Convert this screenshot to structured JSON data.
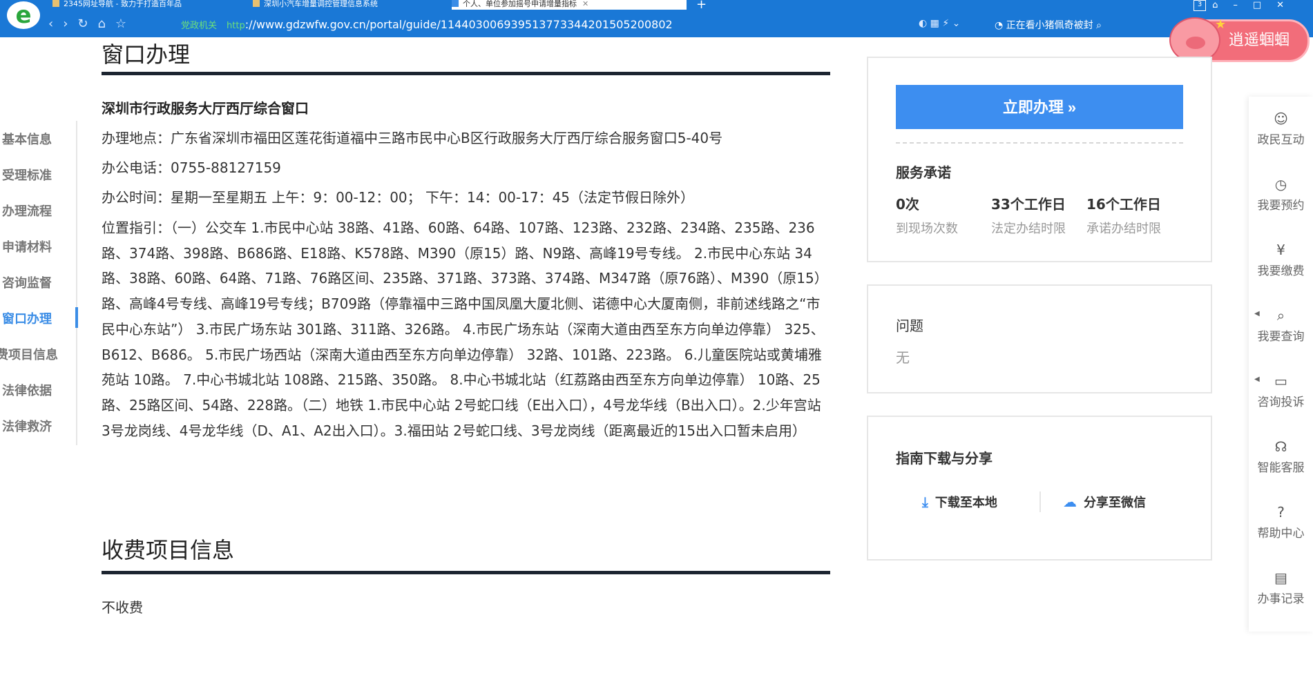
{
  "browser": {
    "tabs": [
      {
        "label": "2345网址导航 - 致力于打造百年品"
      },
      {
        "label": "深圳小汽车增量调控管理信息系统"
      },
      {
        "label": "个人、单位参加摇号申请增量指标"
      }
    ],
    "tab_count": "3",
    "url_tag1": "党政机关",
    "url_tag2": "http",
    "url": "://www.gdzwfw.gov.cn/portal/guide/11440300693951377334420150520080​2",
    "news": "正在看小猪佩奇被封"
  },
  "pig_badge": {
    "label": "逍遥蝈蝈"
  },
  "left_nav": {
    "items": [
      {
        "label": "基本信息"
      },
      {
        "label": "受理标准"
      },
      {
        "label": "办理流程"
      },
      {
        "label": "申请材料"
      },
      {
        "label": "咨询监督"
      },
      {
        "label": "窗口办理"
      },
      {
        "label": "费项目信息"
      },
      {
        "label": "法律依据"
      },
      {
        "label": "法律救济"
      }
    ],
    "active_index": 5
  },
  "window_section": {
    "title": "窗口办理",
    "window_name": "深圳市行政服务大厅西厅综合窗口",
    "address": "办理地点：广东省深圳市福田区莲花街道福中三路市民中心B区行政服务大厅西厅综合服务窗口5-40号",
    "phone": "办公电话：0755-88127159",
    "hours": "办公时间：星期一至星期五 上午：9：00-12：00； 下午：14：00-17：45（法定节假日除外）",
    "directions": "位置指引：（一）公交车 1.市民中心站 38路、41路、60路、64路、107路、123路、232路、234路、235路、236路、374路、398路、B686路、E18路、K578路、M390（原15）路、N9路、高峰19号专线。 2.市民中心东站 34路、38路、60路、64路、71路、76路区间、235路、371路、373路、374路、M347路（原76路）、M390（原15）路、高峰4号专线、高峰19号专线；B709路（停靠福中三路中国凤凰大厦北侧、诺德中心大厦南侧，非前述线路之“市民中心东站”） 3.市民广场东站 301路、311路、326路。 4.市民广场东站（深南大道由西至东方向单边停靠） 325、B612、B686。 5.市民广场西站（深南大道由西至东方向单边停靠） 32路、101路、223路。 6.儿童医院站或黄埔雅苑站 10路。 7.中心书城北站 108路、215路、350路。 8.中心书城北站（红荔路由西至东方向单边停靠） 10路、25路、25路区间、54路、228路。（二）地铁 1.市民中心站 2号蛇口线（E出入口），4号龙华线（B出入口）。2.少年宫站 3号龙岗线、4号龙华线（D、A1、A2出入口）。3.福田站 2号蛇口线、3号龙岗线（距离最近的15出入口暂未启用）"
  },
  "fee_section": {
    "title": "收费项目信息",
    "text": "不收费"
  },
  "service_card": {
    "button_label": "立即办理 »",
    "heading": "服务承诺",
    "stats": [
      {
        "value": "0次",
        "label": "到现场次数"
      },
      {
        "value": "33个工作日",
        "label": "法定办结时限"
      },
      {
        "value": "16个工作日",
        "label": "承诺办结时限"
      }
    ]
  },
  "question_card": {
    "title": "问题",
    "answer": "无"
  },
  "share_card": {
    "heading": "指南下载与分享",
    "download_label": "下载至本地",
    "share_label": "分享至微信"
  },
  "right_bar": {
    "items": [
      {
        "label": "政民互动"
      },
      {
        "label": "我要预约"
      },
      {
        "label": "我要缴费"
      },
      {
        "label": "我要查询"
      },
      {
        "label": "咨询投诉"
      },
      {
        "label": "智能客服"
      },
      {
        "label": "帮助中心"
      },
      {
        "label": "办事记录"
      }
    ]
  },
  "colors": {
    "accent": "#3d8ef0",
    "nav_active": "#3b8de6",
    "chrome": "#1a78d6"
  }
}
